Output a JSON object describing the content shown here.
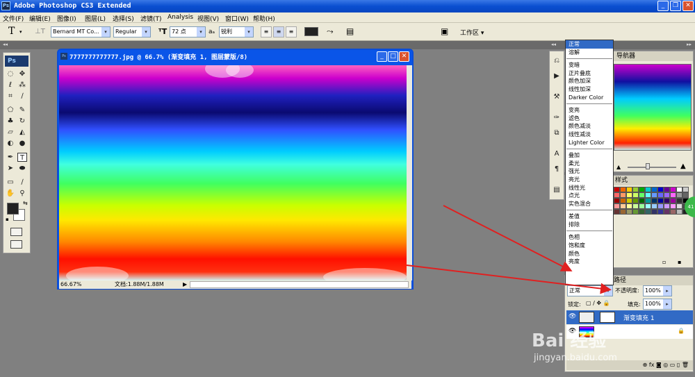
{
  "app": {
    "title": "Adobe Photoshop CS3 Extended",
    "logo": "Ps"
  },
  "window_controls": {
    "minimize": "_",
    "restore": "❐",
    "close": "✕"
  },
  "menu": [
    "文件(F)",
    "编辑(E)",
    "图像(I)",
    "图层(L)",
    "选择(S)",
    "滤镜(T)",
    "Analysis",
    "视图(V)",
    "窗口(W)",
    "帮助(H)"
  ],
  "options": {
    "tool_icon": "T",
    "font_family": "Bernard MT Co...",
    "font_style": "Regular",
    "font_size": "72 点",
    "aa_label": "aₐ",
    "antialias": "锐利",
    "workspace_label": "工作区 ▾"
  },
  "document": {
    "title": "7777777777777.jpg @ 66.7% (渐变填充 1, 图层蒙版/8)",
    "zoom": "66.67%",
    "doc_info": "文档:1.88M/1.88M"
  },
  "navigator": {
    "tab": "导航器"
  },
  "styles": {
    "tab": "样式"
  },
  "blend_modes": {
    "groups": [
      [
        "正常",
        "溶解"
      ],
      [
        "变暗",
        "正片叠底",
        "颜色加深",
        "线性加深",
        "Darker Color"
      ],
      [
        "变亮",
        "滤色",
        "颜色减淡",
        "线性减淡",
        "Lighter Color"
      ],
      [
        "叠加",
        "柔光",
        "强光",
        "亮光",
        "线性光",
        "点光",
        "实色混合"
      ],
      [
        "差值",
        "排除"
      ],
      [
        "色相",
        "饱和度",
        "颜色",
        "亮度"
      ]
    ],
    "selected": "正常"
  },
  "layers": {
    "tab_paths": "路径",
    "blend_value": "正常",
    "opacity_label": "不透明度:",
    "opacity_value": "100%",
    "lock_label": "锁定:",
    "fill_label": "填充:",
    "fill_value": "100%",
    "layer_name": "渐变填充 1",
    "footer_icons": "⊕ fx ◙ ◎ ▭ ▯ 🗑"
  },
  "watermark": {
    "brand": "Bai 经验",
    "url": "jingyan.baidu.com"
  },
  "colors": {
    "titlebar": "#0a4fd0",
    "chrome": "#ece9d8",
    "selection": "#316ac5",
    "arrow": "#e02020"
  }
}
